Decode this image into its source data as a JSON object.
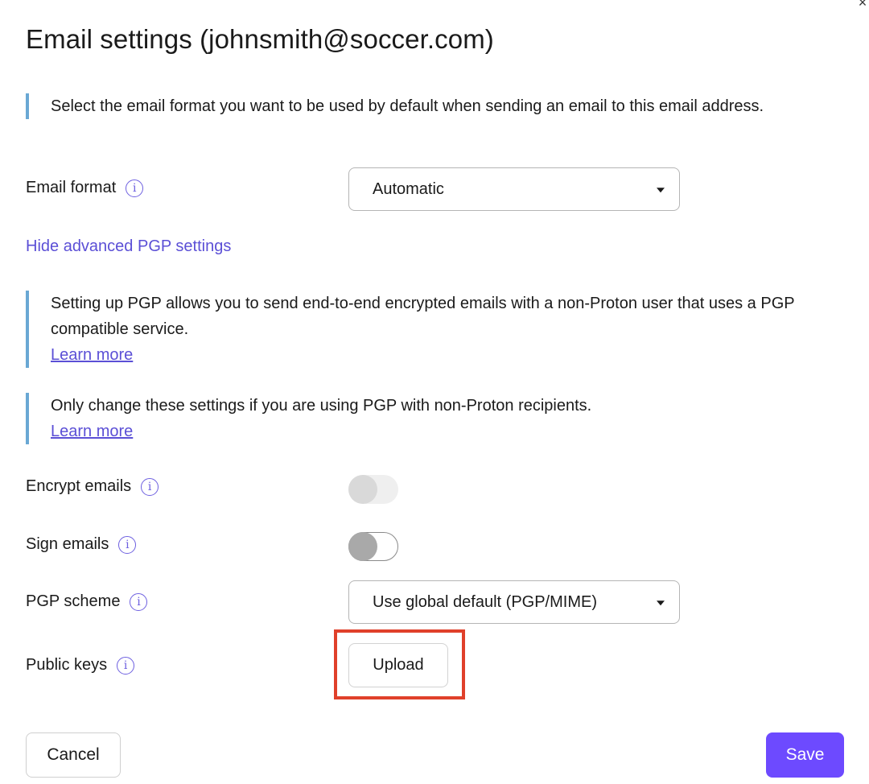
{
  "modal": {
    "title": "Email settings (johnsmith@soccer.com)",
    "close_glyph": "×"
  },
  "format_callout": {
    "text": "Select the email format you want to be used by default when sending an email to this email address."
  },
  "email_format": {
    "label": "Email format",
    "selected": "Automatic"
  },
  "advanced_toggle_link": "Hide advanced PGP settings",
  "pgp_callout": {
    "text": "Setting up PGP allows you to send end-to-end encrypted emails with a non-Proton user that uses a PGP compatible service.",
    "link": "Learn more"
  },
  "warning_callout": {
    "text": "Only change these settings if you are using PGP with non-Proton recipients.",
    "link": "Learn more"
  },
  "encrypt_emails": {
    "label": "Encrypt emails",
    "state": "off-disabled"
  },
  "sign_emails": {
    "label": "Sign emails",
    "state": "off"
  },
  "pgp_scheme": {
    "label": "PGP scheme",
    "selected": "Use global default (PGP/MIME)"
  },
  "public_keys": {
    "label": "Public keys",
    "upload_label": "Upload"
  },
  "footer": {
    "cancel_label": "Cancel",
    "save_label": "Save"
  },
  "icons": {
    "info": "i"
  },
  "colors": {
    "accent": "#6d4aff",
    "link": "#5b4fd6",
    "callout_bar": "#6aa8d4",
    "highlight": "#e0402a"
  }
}
